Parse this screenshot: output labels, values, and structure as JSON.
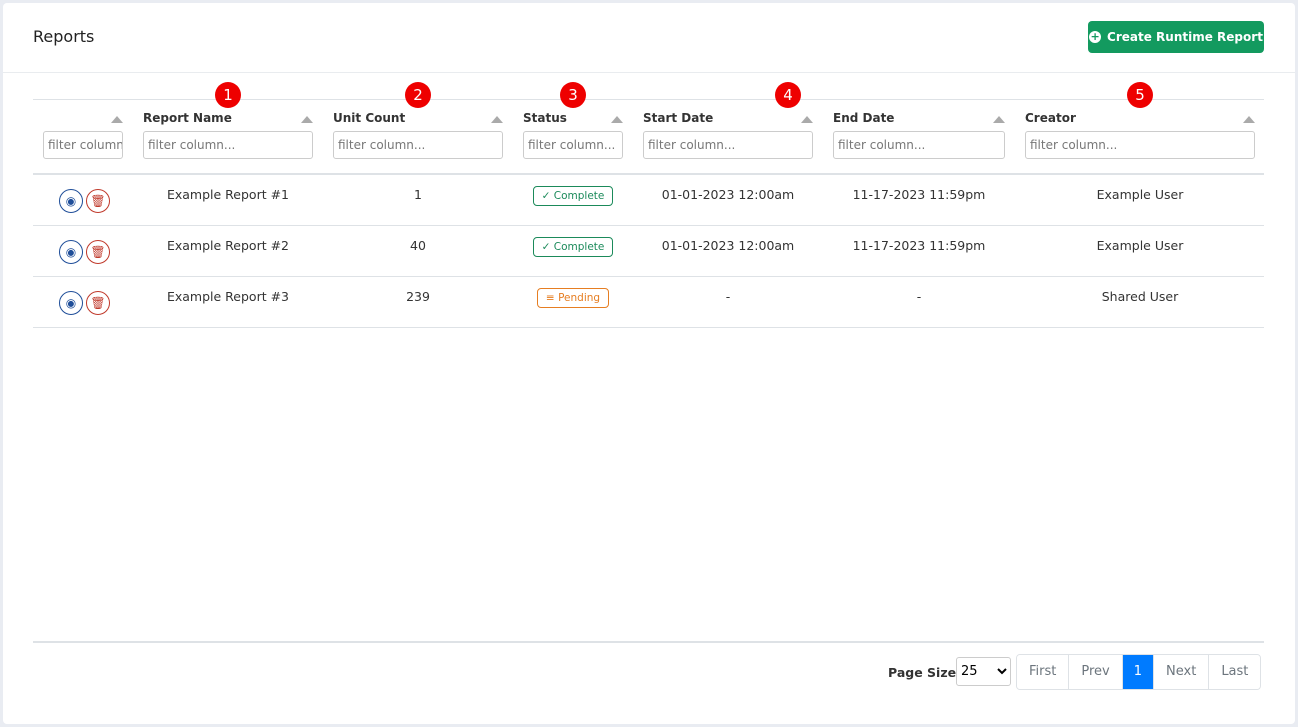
{
  "header": {
    "title": "Reports",
    "create_label": "Create Runtime Report"
  },
  "columns": [
    {
      "label": "",
      "placeholder": "filter column..."
    },
    {
      "label": "Report Name",
      "placeholder": "filter column...",
      "badge": "1"
    },
    {
      "label": "Unit Count",
      "placeholder": "filter column...",
      "badge": "2"
    },
    {
      "label": "Status",
      "placeholder": "filter column...",
      "badge": "3"
    },
    {
      "label": "Start Date",
      "placeholder": "filter column...",
      "badge": "4"
    },
    {
      "label": "End Date",
      "placeholder": "filter column..."
    },
    {
      "label": "Creator",
      "placeholder": "filter column...",
      "badge": "5"
    }
  ],
  "rows": [
    {
      "name": "Example Report #1",
      "count": "1",
      "status": "Complete",
      "start": "01-01-2023 12:00am",
      "end": "11-17-2023 11:59pm",
      "creator": "Example User"
    },
    {
      "name": "Example Report #2",
      "count": "40",
      "status": "Complete",
      "start": "01-01-2023 12:00am",
      "end": "11-17-2023 11:59pm",
      "creator": "Example User"
    },
    {
      "name": "Example Report #3",
      "count": "239",
      "status": "Pending",
      "start": "-",
      "end": "-",
      "creator": "Shared User"
    }
  ],
  "status_colors": {
    "Complete": "#1b8a5a",
    "Pending": "#e67e22"
  },
  "pagination": {
    "page_size_label": "Page Size",
    "page_size": "25",
    "first": "First",
    "prev": "Prev",
    "current": "1",
    "next": "Next",
    "last": "Last"
  }
}
